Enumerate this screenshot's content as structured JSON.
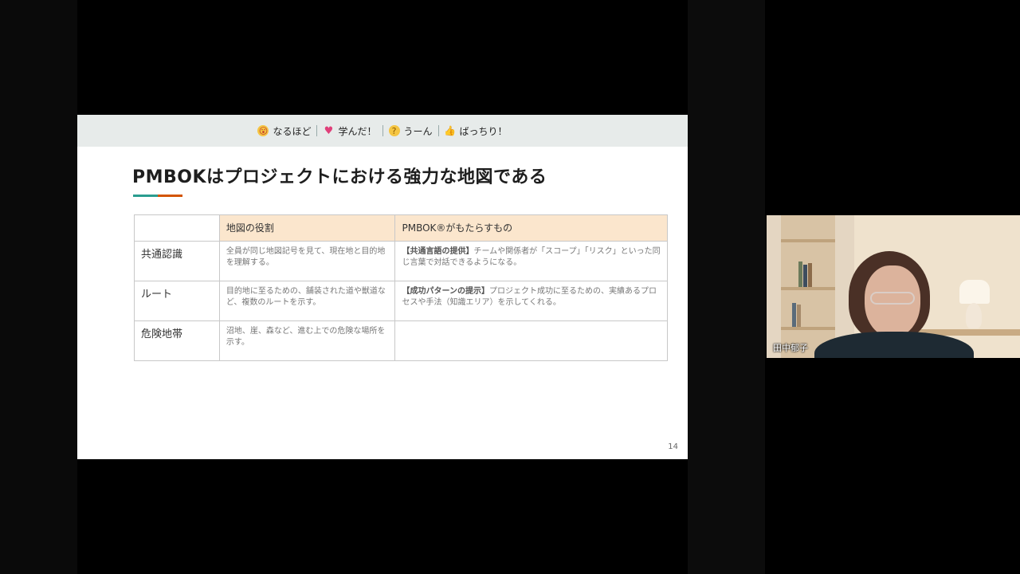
{
  "reactions": [
    {
      "icon": "surprised-face-icon",
      "label": "なるほど",
      "color": "#e05a4a"
    },
    {
      "icon": "heart-icon",
      "label": "学んだ！",
      "color": "#e0407a"
    },
    {
      "icon": "thinking-face-icon",
      "label": "うーん",
      "color": "#e8a33c"
    },
    {
      "icon": "thumbs-up-icon",
      "label": "ばっちり！",
      "color": "#f0b63a"
    }
  ],
  "slide": {
    "title": "PMBOKはプロジェクトにおける強力な地図である",
    "page_number": "14",
    "table": {
      "headers": [
        "",
        "地図の役割",
        "PMBOK®がもたらすもの"
      ],
      "rows": [
        {
          "label": "共通認識",
          "role": "全員が同じ地図記号を見て、現在地と目的地を理解する。",
          "pmbok_lead": "【共通言語の提供】",
          "pmbok_text": "チームや関係者が「スコープ」「リスク」といった同じ言葉で対話できるようになる。"
        },
        {
          "label": "ルート",
          "role": "目的地に至るための、舗装された道や獣道など、複数のルートを示す。",
          "pmbok_lead": "【成功パターンの提示】",
          "pmbok_text": "プロジェクト成功に至るための、実績あるプロセスや手法（知識エリア）を示してくれる。"
        },
        {
          "label": "危険地帯",
          "role": "沼地、崖、森など、進む上での危険な場所を示す。",
          "pmbok_lead": "",
          "pmbok_text": ""
        }
      ]
    },
    "accent_colors": [
      "#2a9d8f",
      "#d35400"
    ]
  },
  "participant": {
    "name": "田中郁子"
  }
}
